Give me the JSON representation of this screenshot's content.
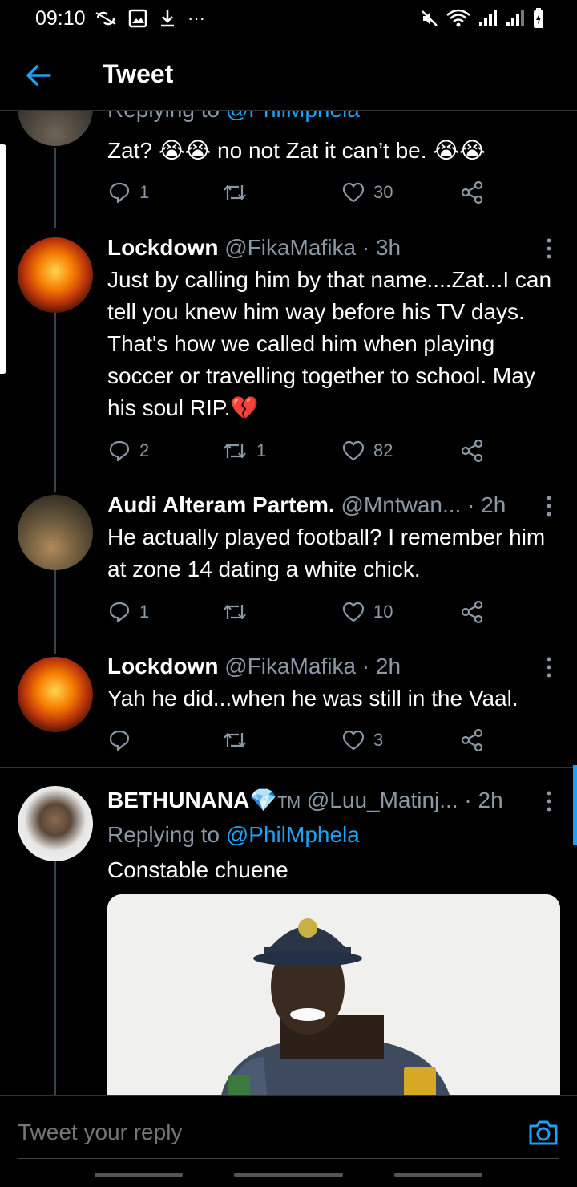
{
  "status_bar": {
    "time": "09:10",
    "more": "···"
  },
  "header": {
    "title": "Tweet"
  },
  "tweets": [
    {
      "replying_prefix": "Replying to",
      "replying_handle": "@PhilMphela",
      "text_a": "Zat?",
      "text_b": "no not Zat it can’t be.",
      "emoji": "😭😭",
      "replies": "1",
      "retweets": "",
      "likes": "30"
    },
    {
      "name": "Lockdown",
      "handle": "@FikaMafika · 3h",
      "text": "Just by calling him by that name....Zat...I can tell you knew him way before his TV days. That's how we called him when playing soccer or travelling together to school. May his soul RIP.",
      "emoji": "💔",
      "replies": "2",
      "retweets": "1",
      "likes": "82"
    },
    {
      "name": "Audi Alteram Partem.",
      "handle": "@Mntwan... · 2h",
      "text": "He actually played football? I remember him at zone 14 dating a white chick.",
      "replies": "1",
      "retweets": "",
      "likes": "10"
    },
    {
      "name": "Lockdown",
      "handle": "@FikaMafika · 2h",
      "text": "Yah he did...when he was still in the Vaal.",
      "replies": "",
      "retweets": "",
      "likes": "3"
    },
    {
      "name": "BETHUNANA",
      "emoji": "💎",
      "tm": "TM",
      "handle": "@Luu_Matinj... · 2h",
      "replying_prefix": "Replying to",
      "replying_handle": "@PhilMphela",
      "text": "Constable chuene"
    }
  ],
  "reply_bar": {
    "placeholder": "Tweet your reply"
  },
  "colors": {
    "accent": "#1da1f2",
    "muted": "#8b98a5",
    "background": "#000000"
  }
}
